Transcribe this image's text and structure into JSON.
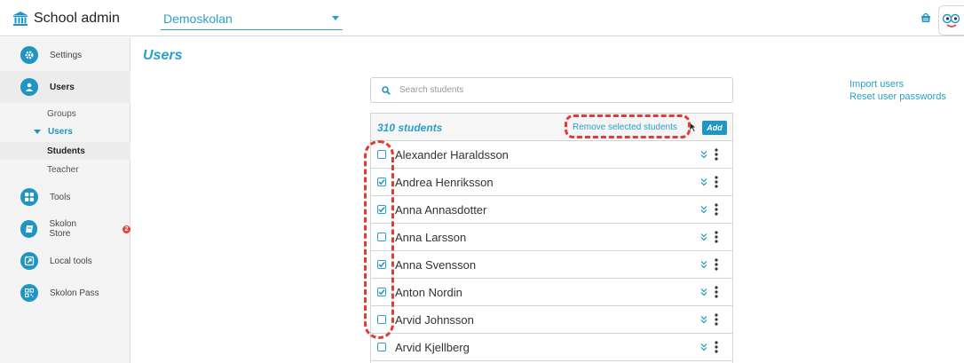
{
  "app": {
    "title": "School admin"
  },
  "school_selector": {
    "value": "Demoskolan"
  },
  "sidebar": {
    "items": [
      {
        "label": "Settings",
        "icon": "gear-icon"
      },
      {
        "label": "Users",
        "icon": "user-icon"
      },
      {
        "label": "Tools",
        "icon": "grid-icon"
      },
      {
        "label": "Skolon Store",
        "icon": "store-icon",
        "badge": "2"
      },
      {
        "label": "Local tools",
        "icon": "external-link-icon"
      },
      {
        "label": "Skolon Pass",
        "icon": "qr-code-icon"
      }
    ],
    "sub_items": {
      "groups": "Groups",
      "users": "Users",
      "students": "Students",
      "teacher": "Teacher"
    }
  },
  "page": {
    "title": "Users"
  },
  "search": {
    "placeholder": "Search students",
    "value": ""
  },
  "side_links": {
    "import": "Import users",
    "reset": "Reset user passwords"
  },
  "list": {
    "count_label": "310 students",
    "remove_label": "Remove selected students",
    "add_label": "Add",
    "rows": [
      {
        "name": "Alexander Haraldsson",
        "checked": false
      },
      {
        "name": "Andrea Henriksson",
        "checked": true
      },
      {
        "name": "Anna Annasdotter",
        "checked": true
      },
      {
        "name": "Anna Larsson",
        "checked": false
      },
      {
        "name": "Anna Svensson",
        "checked": true
      },
      {
        "name": "Anton Nordin",
        "checked": true
      },
      {
        "name": "Arvid Johnsson",
        "checked": false
      },
      {
        "name": "Arvid Kjellberg",
        "checked": false
      }
    ]
  },
  "colors": {
    "accent": "#2a9fc9",
    "nav_icon": "#1e95c2",
    "annotation": "#e53935",
    "badge": "#e0463a"
  }
}
